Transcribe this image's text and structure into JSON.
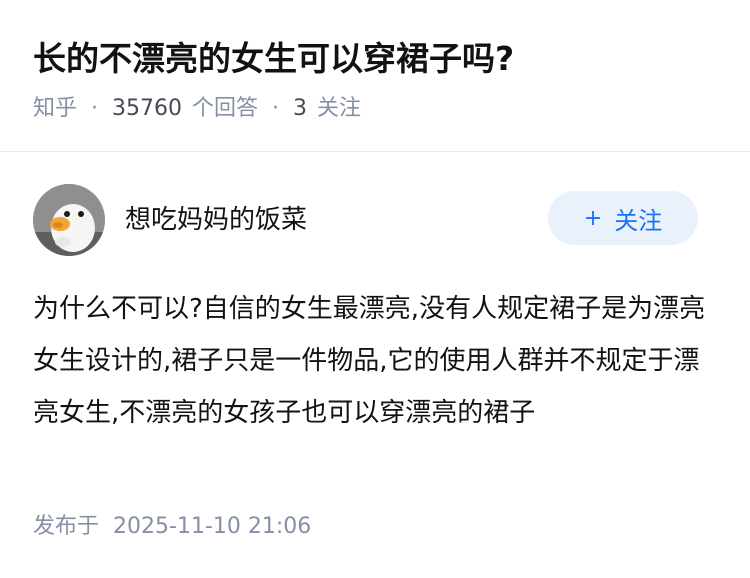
{
  "question": {
    "title": "长的不漂亮的女生可以穿裙子吗?",
    "source": "知乎",
    "answer_count": "35760",
    "answer_count_label": "个回答",
    "follow_count": "3",
    "follow_label": "关注"
  },
  "author": {
    "name": "想吃妈妈的饭菜",
    "avatar": "duck-avatar",
    "follow_button_label": "关注",
    "follow_icon": "plus-icon"
  },
  "answer": {
    "text": "为什么不可以?自信的女生最漂亮,没有人规定裙子是为漂亮女生设计的,裙子只是一件物品,它的使用人群并不规定于漂亮女生,不漂亮的女孩子也可以穿漂亮的裙子",
    "published_label": "发布于",
    "published_time": "2025-11-10 21:06"
  },
  "colors": {
    "accent": "#1772f6",
    "meta": "#8590a6",
    "button_bg": "#e9f1fb"
  }
}
